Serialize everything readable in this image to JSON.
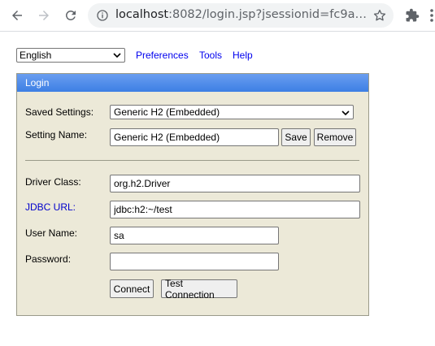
{
  "browser": {
    "url_host": "localhost",
    "url_rest": ":8082/login.jsp?jsessionid=fc9a…",
    "icons": {
      "back": "arrow-left-icon",
      "forward": "arrow-right-icon",
      "reload": "reload-icon",
      "info": "info-icon",
      "bookmark": "star-icon",
      "extensions": "puzzle-icon",
      "menu": "kebab-menu-icon"
    }
  },
  "topbar": {
    "language": "English",
    "links": [
      "Preferences",
      "Tools",
      "Help"
    ]
  },
  "login": {
    "title": "Login",
    "saved_settings_label": "Saved Settings:",
    "saved_settings_value": "Generic H2 (Embedded)",
    "setting_name_label": "Setting Name:",
    "setting_name_value": "Generic H2 (Embedded)",
    "save_label": "Save",
    "remove_label": "Remove",
    "driver_class_label": "Driver Class:",
    "driver_class_value": "org.h2.Driver",
    "jdbc_url_label": "JDBC URL:",
    "jdbc_url_value": "jdbc:h2:~/test",
    "user_name_label": "User Name:",
    "user_name_value": "sa",
    "password_label": "Password:",
    "password_value": "",
    "connect_label": "Connect",
    "test_connection_label": "Test Connection"
  },
  "colors": {
    "panel_bg": "#ece9d8",
    "header_blue": "#3d7fe4",
    "link_blue": "#0000ee"
  }
}
